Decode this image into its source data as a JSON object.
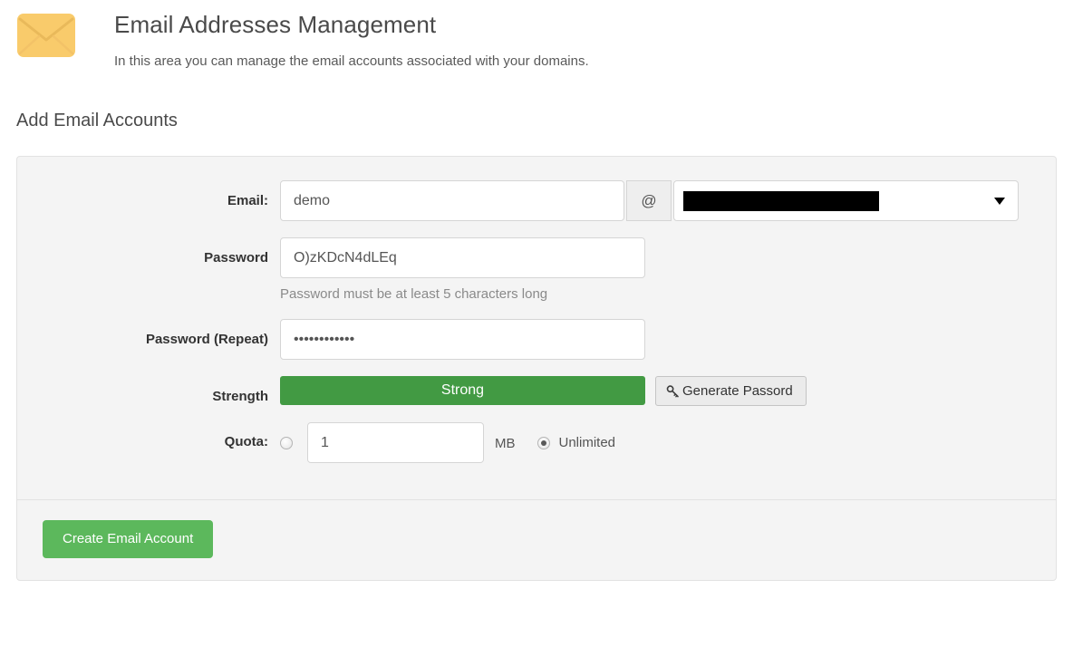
{
  "header": {
    "icon": "envelope-icon",
    "title": "Email Addresses Management",
    "subtitle": "In this area you can manage the email accounts associated with your domains."
  },
  "section": {
    "title": "Add Email Accounts"
  },
  "form": {
    "email": {
      "label": "Email:",
      "value": "demo",
      "placeholder": "",
      "at_symbol": "@",
      "domain_value": "",
      "domain_redacted": true,
      "caret_icon": "chevron-down-icon"
    },
    "password": {
      "label": "Password",
      "value": "O)zKDcN4dLEq",
      "help": "Password must be at least 5 characters long"
    },
    "password_repeat": {
      "label": "Password (Repeat)",
      "value": "••••••••••••"
    },
    "strength": {
      "label": "Strength",
      "value": "Strong",
      "color": "#429a43",
      "generate_button": "Generate Passord",
      "generate_icon": "key-icon"
    },
    "quota": {
      "label": "Quota:",
      "limited_selected": false,
      "value": "1",
      "unit": "MB",
      "unlimited_label": "Unlimited",
      "unlimited_selected": true
    }
  },
  "footer": {
    "submit_label": "Create Email Account",
    "submit_color": "#5cb85c"
  }
}
